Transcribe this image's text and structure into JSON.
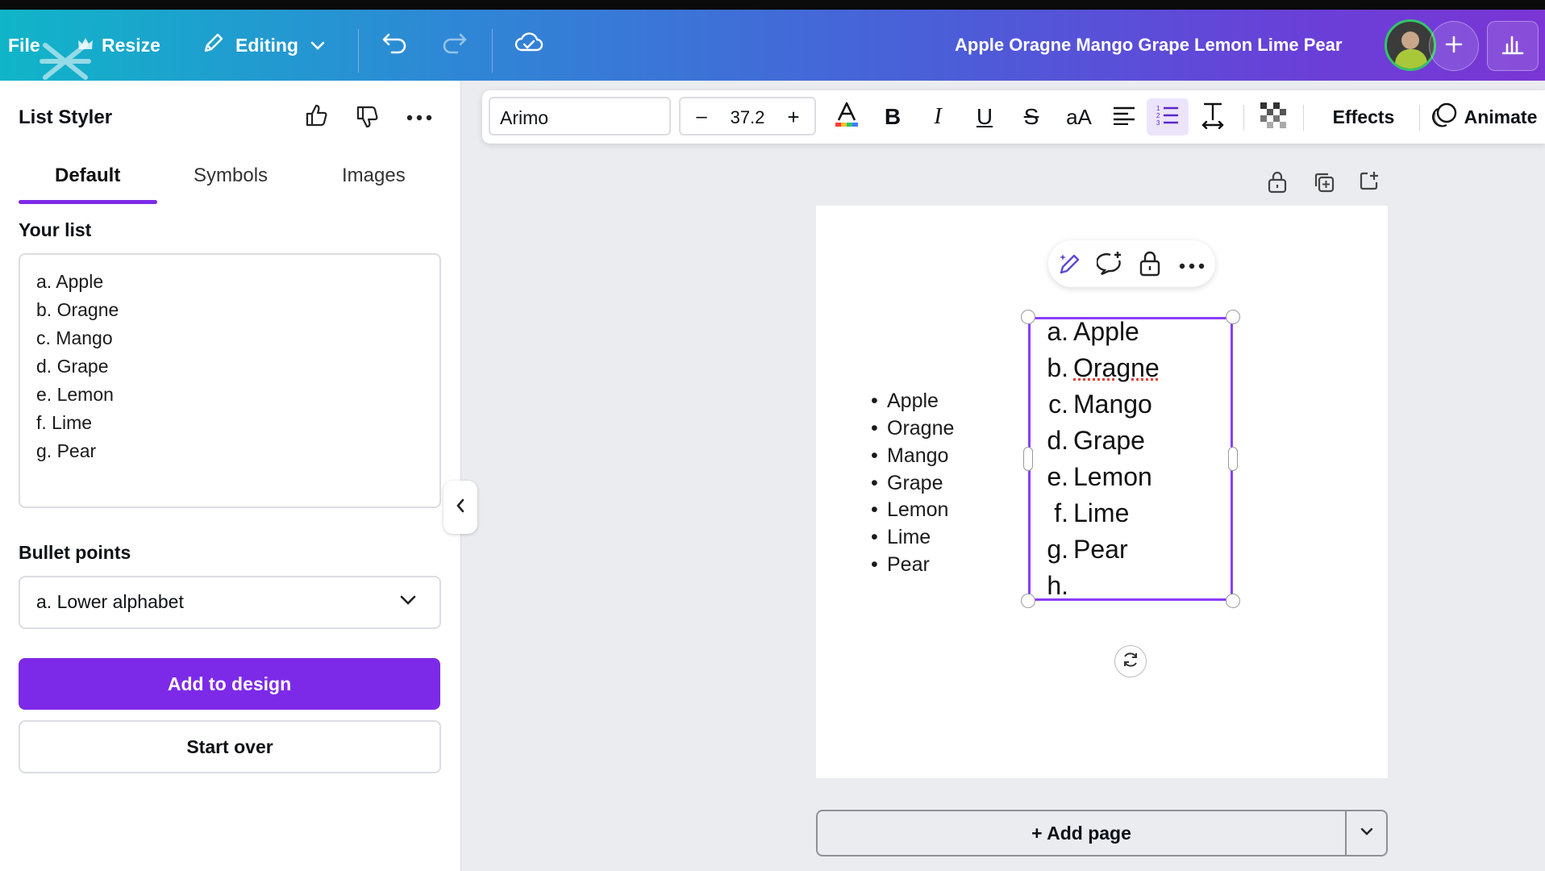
{
  "header": {
    "file_label": "File",
    "resize_label": "Resize",
    "editing_label": "Editing",
    "doc_title": "Apple Oragne Mango Grape Lemon Lime Pear"
  },
  "left_panel": {
    "title": "List Styler",
    "tabs": [
      "Default",
      "Symbols",
      "Images"
    ],
    "your_list_label": "Your list",
    "list_lines": [
      "a. Apple",
      "b. Oragne",
      "c. Mango",
      "d. Grape",
      "e. Lemon",
      "f. Lime",
      "g. Pear"
    ],
    "bullet_points_label": "Bullet points",
    "bullet_style_value": "a. Lower alphabet",
    "add_button": "Add to design",
    "start_over_button": "Start over"
  },
  "toolbar": {
    "font_name": "Arimo",
    "font_size": "37.2",
    "minus": "–",
    "plus": "+",
    "bold": "B",
    "italic": "I",
    "underline": "U",
    "strike": "S",
    "case": "aA",
    "effects_label": "Effects",
    "animate_label": "Animate"
  },
  "canvas": {
    "bullet_list": [
      "Apple",
      "Oragne",
      "Mango",
      "Grape",
      "Lemon",
      "Lime",
      "Pear"
    ],
    "ordered_letters": [
      "a.",
      "b.",
      "c.",
      "d.",
      "e.",
      "f.",
      "g.",
      "h."
    ],
    "ordered_items": [
      "Apple",
      "Oragne",
      "Mango",
      "Grape",
      "Lemon",
      "Lime",
      "Pear",
      ""
    ],
    "add_page_label": "+ Add page"
  },
  "colors": {
    "accent": "#7d2ae8",
    "selection": "#8b3dff"
  }
}
